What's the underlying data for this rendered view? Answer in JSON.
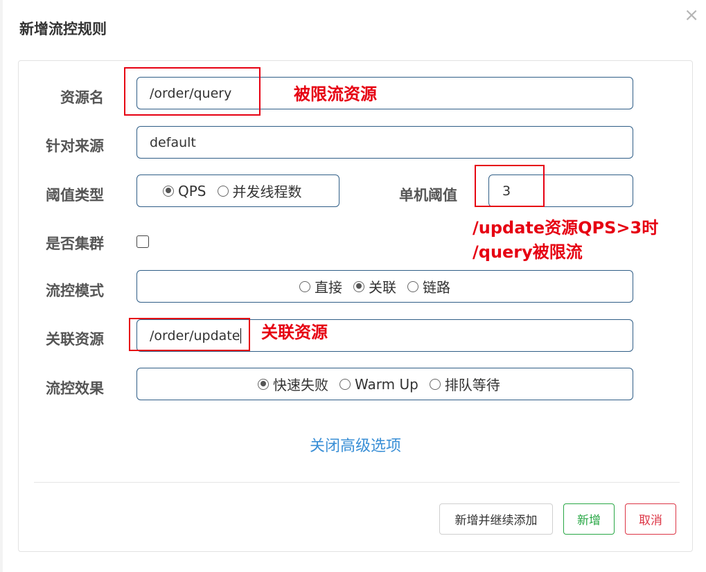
{
  "dialog": {
    "title": "新增流控规则",
    "close_icon": "×"
  },
  "form": {
    "resource": {
      "label": "资源名",
      "value": "/order/query"
    },
    "limit_app": {
      "label": "针对来源",
      "value": "default"
    },
    "grade": {
      "label": "阈值类型",
      "options": [
        "QPS",
        "并发线程数"
      ],
      "selected": "QPS"
    },
    "threshold": {
      "label": "单机阈值",
      "value": "3"
    },
    "cluster": {
      "label": "是否集群",
      "checked": false
    },
    "strategy": {
      "label": "流控模式",
      "options": [
        "直接",
        "关联",
        "链路"
      ],
      "selected": "关联"
    },
    "ref_resource": {
      "label": "关联资源",
      "value": "/order/update"
    },
    "control_behavior": {
      "label": "流控效果",
      "options": [
        "快速失败",
        "Warm Up",
        "排队等待"
      ],
      "selected": "快速失败"
    },
    "advanced_toggle": "关闭高级选项"
  },
  "buttons": {
    "add_continue": "新增并继续添加",
    "add": "新增",
    "cancel": "取消"
  },
  "annotations": {
    "limited_resource": "被限流资源",
    "rule_line1": "/update资源QPS>3时",
    "rule_line2": "/query被限流",
    "ref_resource": "关联资源"
  },
  "colors": {
    "annotation": "#e60012",
    "link": "#3a8fd6",
    "add_button": "#28a745",
    "cancel_button": "#dc3545",
    "input_border": "#2f5d86"
  }
}
